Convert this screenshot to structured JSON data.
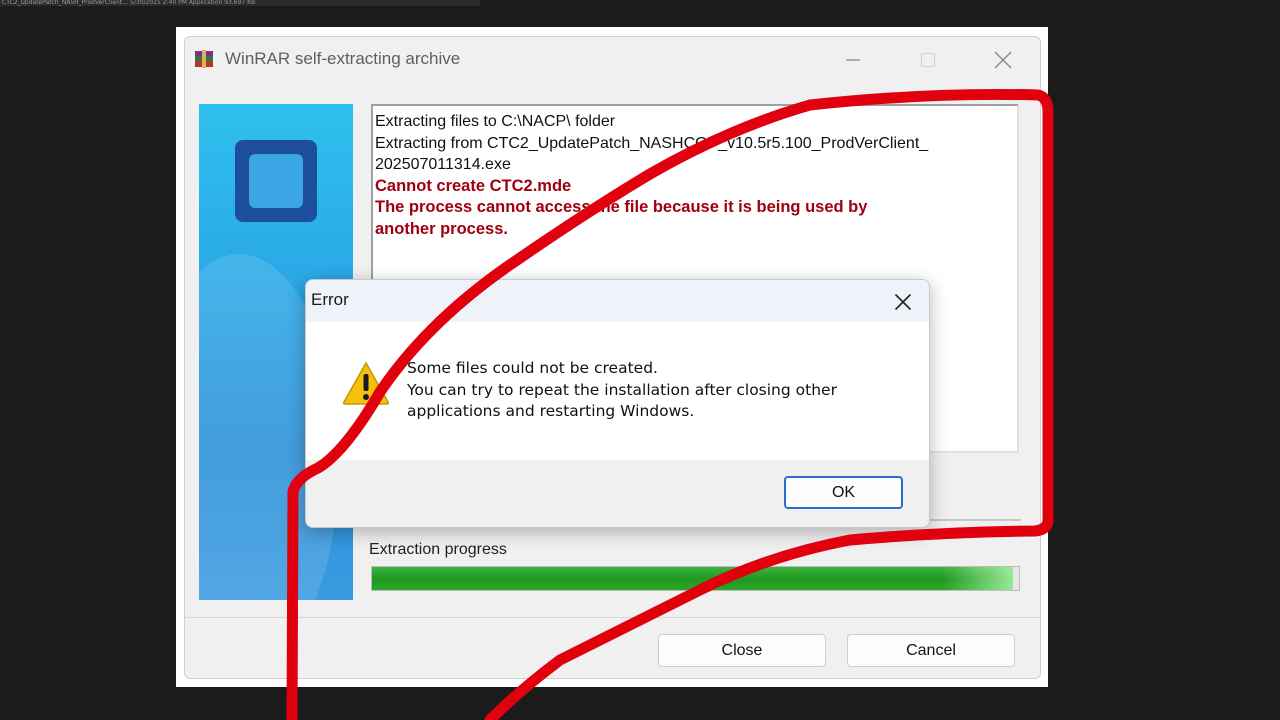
{
  "background_strip": {
    "text": "CTC2_UpdatePatch_NASH_ProdVerClient…      5/30/2025 2:40 PM        Application          93,697 KB"
  },
  "winrar": {
    "title": "WinRAR self-extracting archive",
    "log_lines": [
      "Extracting files to C:\\NACP\\ folder",
      "Extracting from CTC2_UpdatePatch_NASHCOP_v10.5r5.100_ProdVerClient_",
      "202507011314.exe"
    ],
    "log_errors": [
      "Cannot create CTC2.mde",
      "The process cannot access the file because it is being used by",
      "another process."
    ],
    "progress_label": "Extraction progress",
    "progress_fraction": 0.99,
    "buttons": {
      "close": "Close",
      "cancel": "Cancel"
    }
  },
  "error_dialog": {
    "title": "Error",
    "message_lines": [
      "Some files could not be created.",
      "You can try to repeat the installation after closing other",
      "applications and restarting Windows."
    ],
    "ok_label": "OK"
  },
  "colors": {
    "error_text": "#a0000f",
    "progress_green": "#1f9a1f",
    "annotation_red": "#e0000e",
    "warning_yellow": "#f4c20d"
  }
}
